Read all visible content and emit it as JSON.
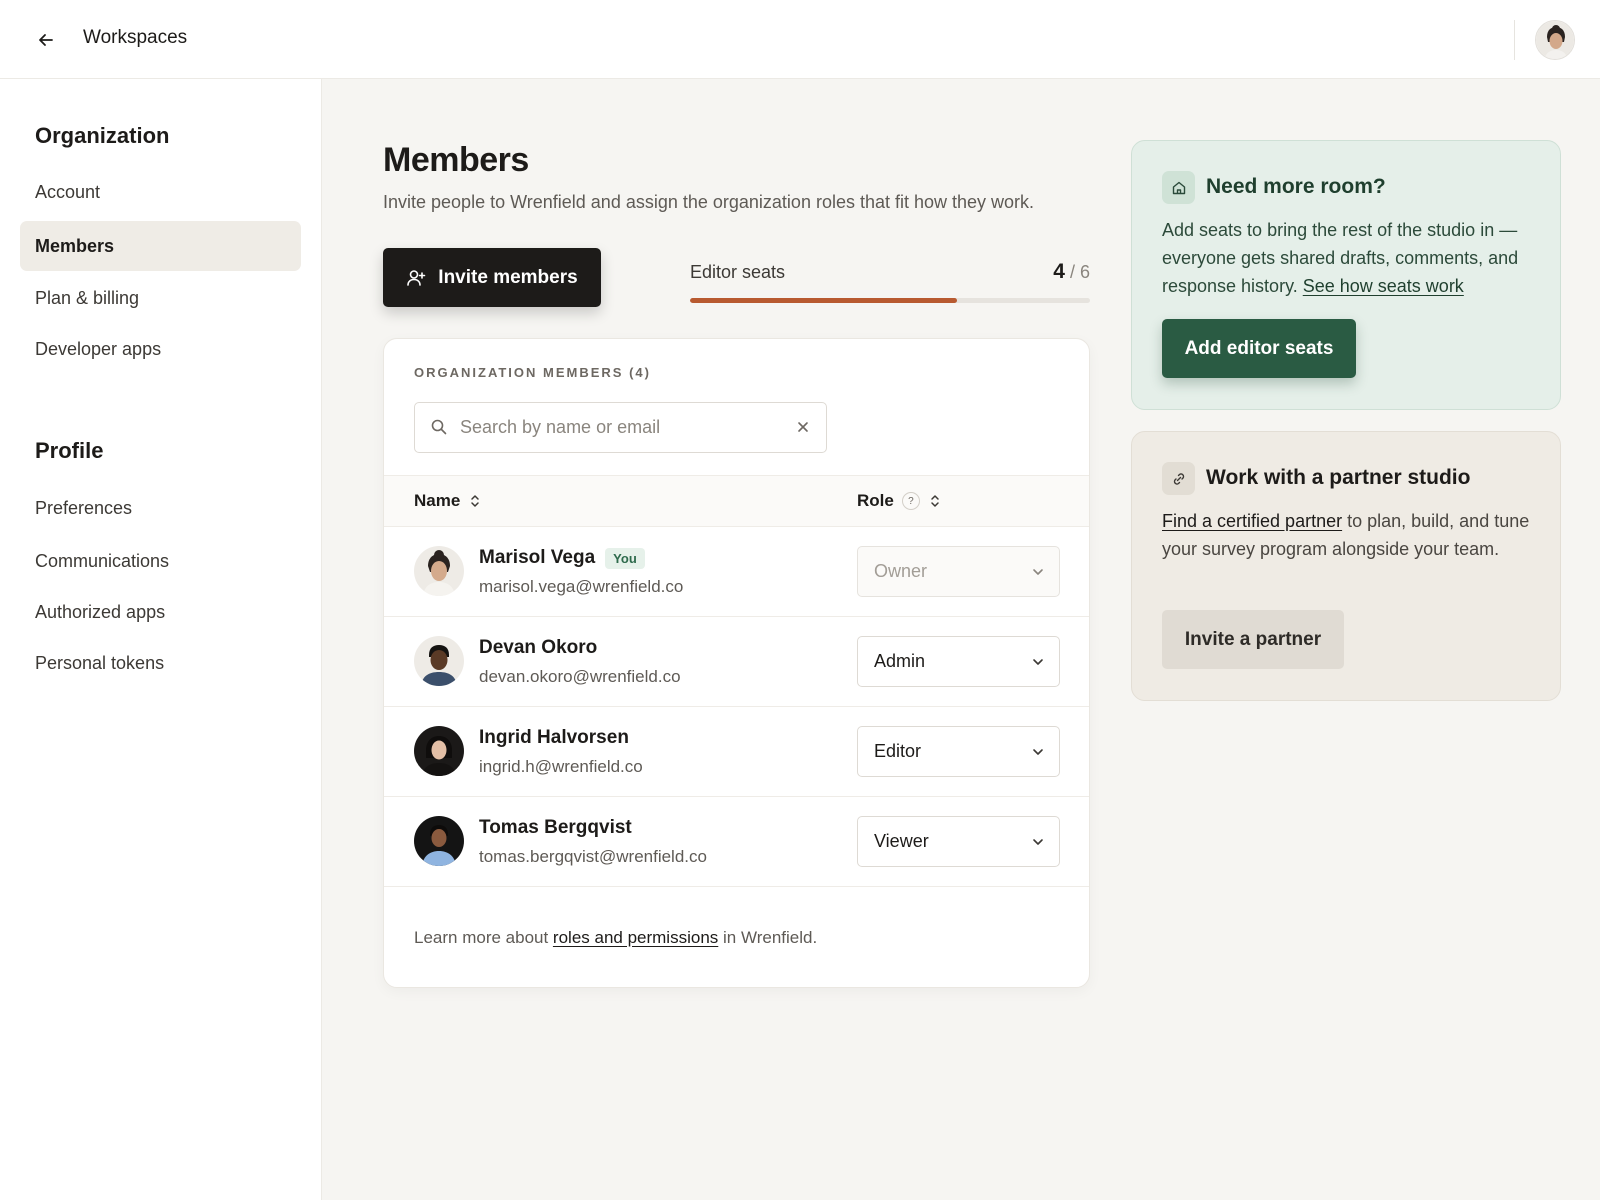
{
  "topbar": {
    "back_icon": "arrow-left-icon",
    "title": "Workspaces"
  },
  "sidebar": {
    "organization": {
      "title": "Organization",
      "items": [
        {
          "label": "Account",
          "active": false
        },
        {
          "label": "Members",
          "active": true
        },
        {
          "label": "Plan & billing",
          "active": false
        },
        {
          "label": "Developer apps",
          "active": false
        }
      ]
    },
    "profile": {
      "title": "Profile",
      "items": [
        {
          "label": "Preferences"
        },
        {
          "label": "Communications"
        },
        {
          "label": "Authorized apps"
        },
        {
          "label": "Personal tokens"
        }
      ]
    }
  },
  "main": {
    "title": "Members",
    "description": "Invite people to Wrenfield and assign the organization roles that fit how they work.",
    "invite_button": "Invite members",
    "seats": {
      "label": "Editor seats",
      "used": "4",
      "total": "/ 6",
      "fill_fraction": 0.6667,
      "fill_color": "#b85a30"
    },
    "members_card": {
      "eyebrow": "ORGANIZATION MEMBERS (4)",
      "search_placeholder": "Search by name or email",
      "columns": {
        "name": "Name",
        "role": "Role",
        "role_help": "?"
      },
      "rows": [
        {
          "name": "Marisol Vega",
          "badge": "You",
          "email": "marisol.vega@wrenfield.co",
          "role": "Owner",
          "disabled": true
        },
        {
          "name": "Devan Okoro",
          "badge": "",
          "email": "devan.okoro@wrenfield.co",
          "role": "Admin",
          "disabled": false
        },
        {
          "name": "Ingrid Halvorsen",
          "badge": "",
          "email": "ingrid.h@wrenfield.co",
          "role": "Editor",
          "disabled": false
        },
        {
          "name": "Tomas Bergqvist",
          "badge": "",
          "email": "tomas.bergqvist@wrenfield.co",
          "role": "Viewer",
          "disabled": false
        }
      ],
      "footer": {
        "prefix": "Learn more about ",
        "link": "roles and permissions",
        "suffix": " in Wrenfield."
      }
    }
  },
  "panels": {
    "room": {
      "icon": "home-icon",
      "title": "Need more room?",
      "body": "Add seats to bring the rest of the studio in — everyone gets shared drafts, comments, and response history. ",
      "link": "See how seats work",
      "button": "Add editor seats",
      "accent": "#2a5b43"
    },
    "partner": {
      "icon": "link-icon",
      "title": "Work with a partner studio",
      "link": "Find a certified partner",
      "body": " to plan, build, and tune your survey program alongside your team.",
      "button": "Invite a partner"
    }
  }
}
